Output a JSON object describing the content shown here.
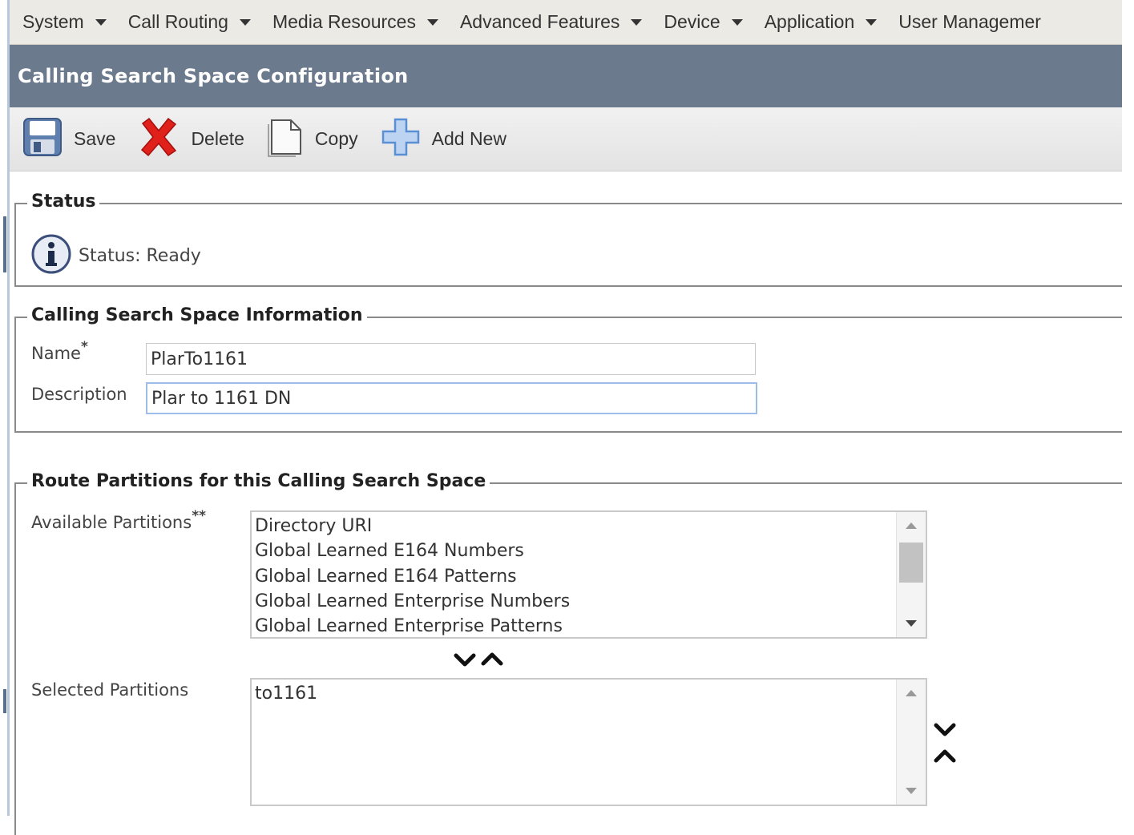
{
  "menu": {
    "items": [
      {
        "label": "System"
      },
      {
        "label": "Call Routing"
      },
      {
        "label": "Media Resources"
      },
      {
        "label": "Advanced Features"
      },
      {
        "label": "Device"
      },
      {
        "label": "Application"
      },
      {
        "label": "User Managemer"
      }
    ]
  },
  "page": {
    "title": "Calling Search Space Configuration"
  },
  "toolbar": {
    "save_label": "Save",
    "delete_label": "Delete",
    "copy_label": "Copy",
    "add_new_label": "Add New"
  },
  "status_section": {
    "legend": "Status",
    "text": "Status: Ready"
  },
  "info_section": {
    "legend": "Calling Search Space Information",
    "name_label": "Name",
    "name_required": "*",
    "name_value": "PlarTo1161",
    "description_label": "Description",
    "description_value": "Plar to 1161 DN"
  },
  "partitions_section": {
    "legend": "Route Partitions for this Calling Search Space",
    "available_label": "Available Partitions",
    "available_required": "**",
    "available_options": [
      "Directory URI",
      "Global Learned E164 Numbers",
      "Global Learned E164 Patterns",
      "Global Learned Enterprise Numbers",
      "Global Learned Enterprise Patterns"
    ],
    "selected_label": "Selected Partitions",
    "selected_options": [
      "to1161"
    ]
  },
  "colors": {
    "title_bar": "#6c7a8e",
    "menu_bar": "#eceae4",
    "delete_red": "#e0201a",
    "add_blue": "#5b8fd4"
  }
}
